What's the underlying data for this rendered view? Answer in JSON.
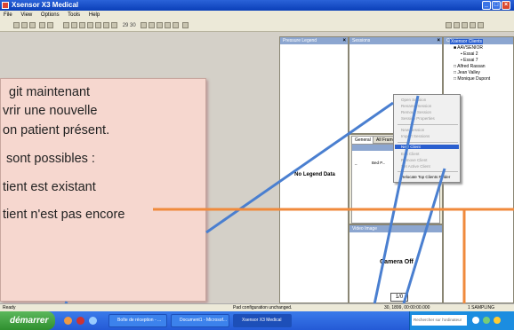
{
  "window": {
    "title": "Xsensor X3 Medical"
  },
  "menubar": {
    "items": [
      "File",
      "View",
      "Options",
      "Tools",
      "Help"
    ]
  },
  "toolbar": {
    "frames_text": "29 30"
  },
  "panels": {
    "legend": {
      "title": "Pressure Legend",
      "empty_text": "No Legend Data"
    },
    "sessions": {
      "title": "Sessions"
    },
    "clients": {
      "title": "Clients"
    },
    "tabs": {
      "general": "General",
      "all_frames": "All Frames"
    },
    "list_header": {
      "col1": "Bed P..."
    },
    "video": {
      "title": "Video Image",
      "empty_text": "Camera Off"
    },
    "frame_counter": "1/0"
  },
  "tree": {
    "root": "Xsensor Clients",
    "items": [
      {
        "label": "AAVSENIOR"
      },
      {
        "label": "Essai 2"
      },
      {
        "label": "Essai 7"
      },
      {
        "label": "Alfred Rassan"
      },
      {
        "label": "Jean Valley"
      },
      {
        "label": "Monique Dupont"
      }
    ]
  },
  "context_menu": {
    "items": [
      {
        "label": "Open Session",
        "enabled": false
      },
      {
        "label": "Rename Session",
        "enabled": false
      },
      {
        "label": "Remove Session",
        "enabled": false
      },
      {
        "label": "Session Properties",
        "enabled": false
      },
      {
        "label": "New Session",
        "enabled": false
      },
      {
        "label": "Import Sessions",
        "enabled": false
      },
      {
        "label": "New Client",
        "enabled": true,
        "highlighted": true
      },
      {
        "label": "Edit Client",
        "enabled": false
      },
      {
        "label": "Remove Client",
        "enabled": false
      },
      {
        "label": "Set Active Client",
        "enabled": false
      },
      {
        "label": "Relocate Top Clients Folder",
        "enabled": true
      }
    ]
  },
  "overlay_note": {
    "lines": [
      "git maintenant",
      "vrir une nouvelle",
      "on patient présent.",
      "sont possibles :",
      "tient est existant",
      "tient n'est pas encore"
    ]
  },
  "statusbar": {
    "ready": "Ready",
    "message": "Pad configuration unchanged.",
    "time": "30, 1899, 00:00:00.000",
    "sampling": "1 SAMPLING"
  },
  "taskbar": {
    "start_label": "démarrer",
    "buttons": [
      "Boîte de réception - ...",
      "Document1 - Microsof...",
      "Xsensor X3 Medical"
    ],
    "search_placeholder": "Rechercher sur l'ordinateur"
  },
  "colors": {
    "note_bg": "#f6d7cf",
    "blue_line": "#4a7fd0",
    "orange_line": "#f08a3c"
  }
}
